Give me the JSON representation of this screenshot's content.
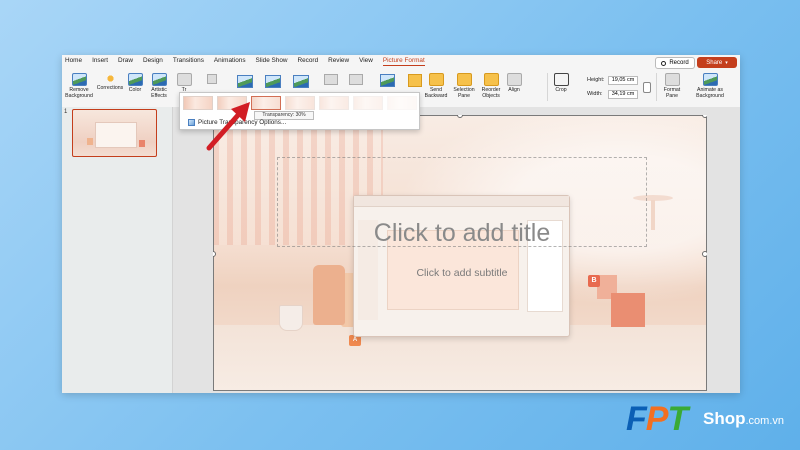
{
  "menu": {
    "tabs": [
      "Home",
      "Insert",
      "Draw",
      "Design",
      "Transitions",
      "Animations",
      "Slide Show",
      "Record",
      "Review",
      "View",
      "Picture Format"
    ],
    "active_tab": "Picture Format",
    "record_label": "Record",
    "share_label": "Share"
  },
  "ribbon": {
    "remove_background": "Remove Background",
    "corrections": "Corrections",
    "color": "Color",
    "artistic_effects": "Artistic Effects",
    "transparency_short": "Tr",
    "send_backward": "Send Backward",
    "selection_pane": "Selection Pane",
    "reorder_objects": "Reorder Objects",
    "align": "Align",
    "crop": "Crop",
    "height_label": "Height:",
    "height_value": "19,05 cm",
    "width_label": "Width:",
    "width_value": "34,19 cm",
    "format_pane": "Format Pane",
    "animate_as_background": "Animate as Background"
  },
  "dropdown": {
    "tooltip": "Transparency: 30%",
    "selected_index": 2,
    "options_label": "Picture Transparency Options..."
  },
  "thumbnails": {
    "slide_number": "1"
  },
  "slide": {
    "title_placeholder": "Click to add title",
    "subtitle_placeholder": "Click to add subtitle",
    "badge_b": "B",
    "badge_a": "A"
  },
  "colors": {
    "accent": "#c43e1c",
    "fpt_blue": "#0b5fb5",
    "fpt_orange": "#f36f21",
    "fpt_green": "#3aaa35"
  },
  "logo": {
    "f": "F",
    "p": "P",
    "t": "T",
    "shop": "Shop",
    "domain": ".com.vn"
  }
}
